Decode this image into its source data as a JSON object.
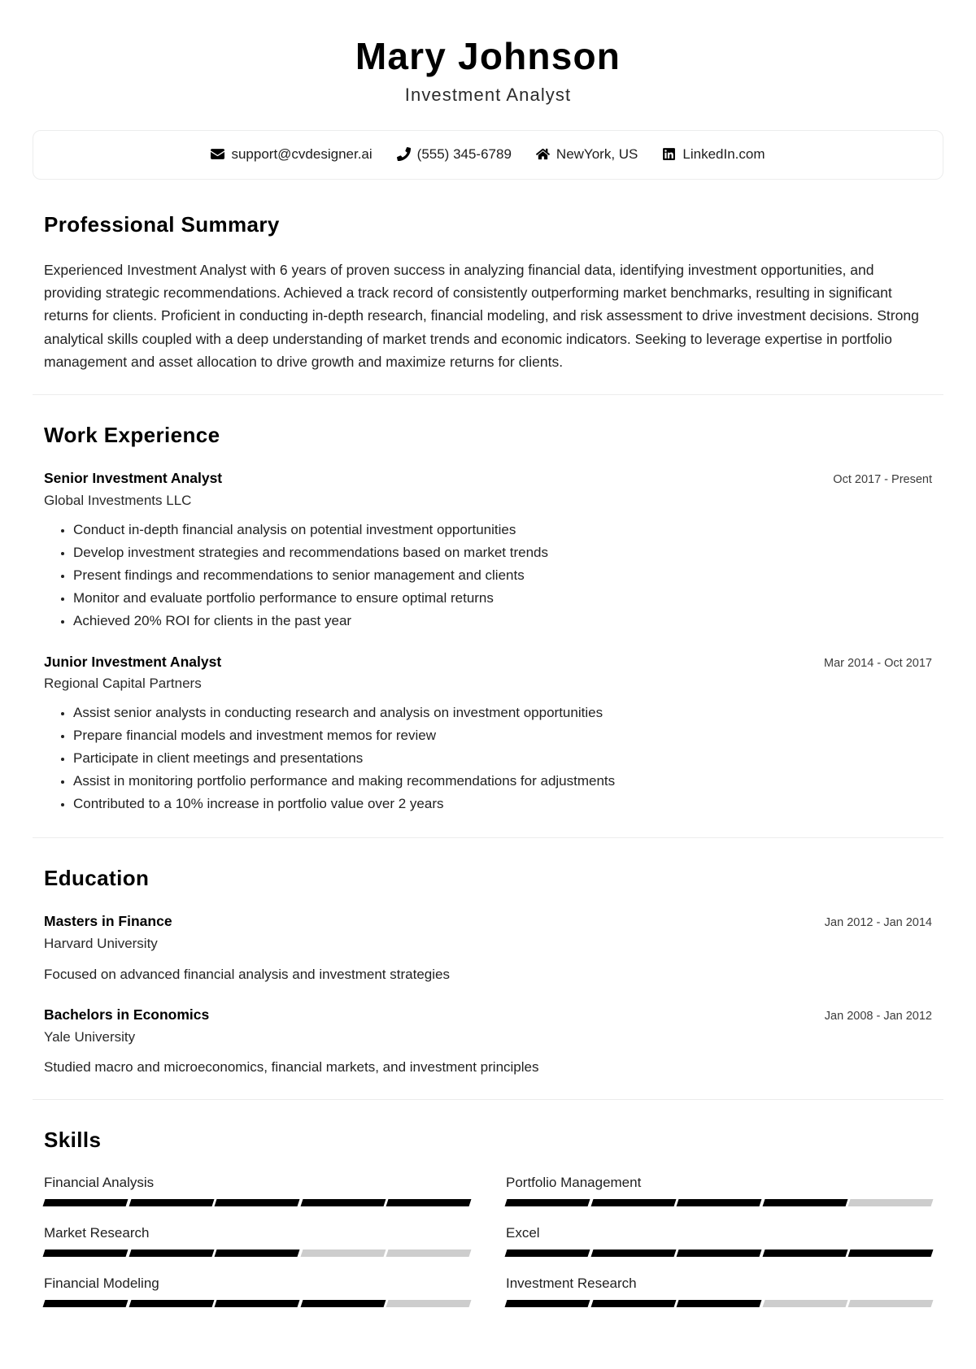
{
  "header": {
    "name": "Mary Johnson",
    "title": "Investment Analyst"
  },
  "contact": {
    "items": [
      {
        "icon": "envelope-icon",
        "label": "support@cvdesigner.ai"
      },
      {
        "icon": "phone-icon",
        "label": "(555) 345-6789"
      },
      {
        "icon": "home-icon",
        "label": "NewYork, US"
      },
      {
        "icon": "linkedin-icon",
        "label": "LinkedIn.com"
      }
    ]
  },
  "summary": {
    "heading": "Professional Summary",
    "text": "Experienced Investment Analyst with 6 years of proven success in analyzing financial data, identifying investment opportunities, and providing strategic recommendations. Achieved a track record of consistently outperforming market benchmarks, resulting in significant returns for clients. Proficient in conducting in-depth research, financial modeling, and risk assessment to drive investment decisions. Strong analytical skills coupled with a deep understanding of market trends and economic indicators. Seeking to leverage expertise in portfolio management and asset allocation to drive growth and maximize returns for clients."
  },
  "work": {
    "heading": "Work Experience",
    "entries": [
      {
        "role": "Senior Investment Analyst",
        "org": "Global Investments LLC",
        "date": "Oct 2017 - Present",
        "bullets": [
          "Conduct in-depth financial analysis on potential investment opportunities",
          "Develop investment strategies and recommendations based on market trends",
          "Present findings and recommendations to senior management and clients",
          "Monitor and evaluate portfolio performance to ensure optimal returns",
          "Achieved 20% ROI for clients in the past year"
        ]
      },
      {
        "role": "Junior Investment Analyst",
        "org": "Regional Capital Partners",
        "date": "Mar 2014 - Oct 2017",
        "bullets": [
          "Assist senior analysts in conducting research and analysis on investment opportunities",
          "Prepare financial models and investment memos for review",
          "Participate in client meetings and presentations",
          "Assist in monitoring portfolio performance and making recommendations for adjustments",
          "Contributed to a 10% increase in portfolio value over 2 years"
        ]
      }
    ]
  },
  "education": {
    "heading": "Education",
    "entries": [
      {
        "degree": "Masters in Finance",
        "school": "Harvard University",
        "date": "Jan 2012 - Jan 2014",
        "description": "Focused on advanced financial analysis and investment strategies"
      },
      {
        "degree": "Bachelors in Economics",
        "school": "Yale University",
        "date": "Jan 2008 - Jan 2012",
        "description": "Studied macro and microeconomics, financial markets, and investment principles"
      }
    ]
  },
  "skills": {
    "heading": "Skills",
    "max_level": 5,
    "filled_color": "#000000",
    "empty_color": "#cdcdcd",
    "items": [
      {
        "name": "Financial Analysis",
        "level": 5
      },
      {
        "name": "Portfolio Management",
        "level": 4
      },
      {
        "name": "Market Research",
        "level": 3
      },
      {
        "name": "Excel",
        "level": 5
      },
      {
        "name": "Financial Modeling",
        "level": 4
      },
      {
        "name": "Investment Research",
        "level": 3
      }
    ]
  }
}
